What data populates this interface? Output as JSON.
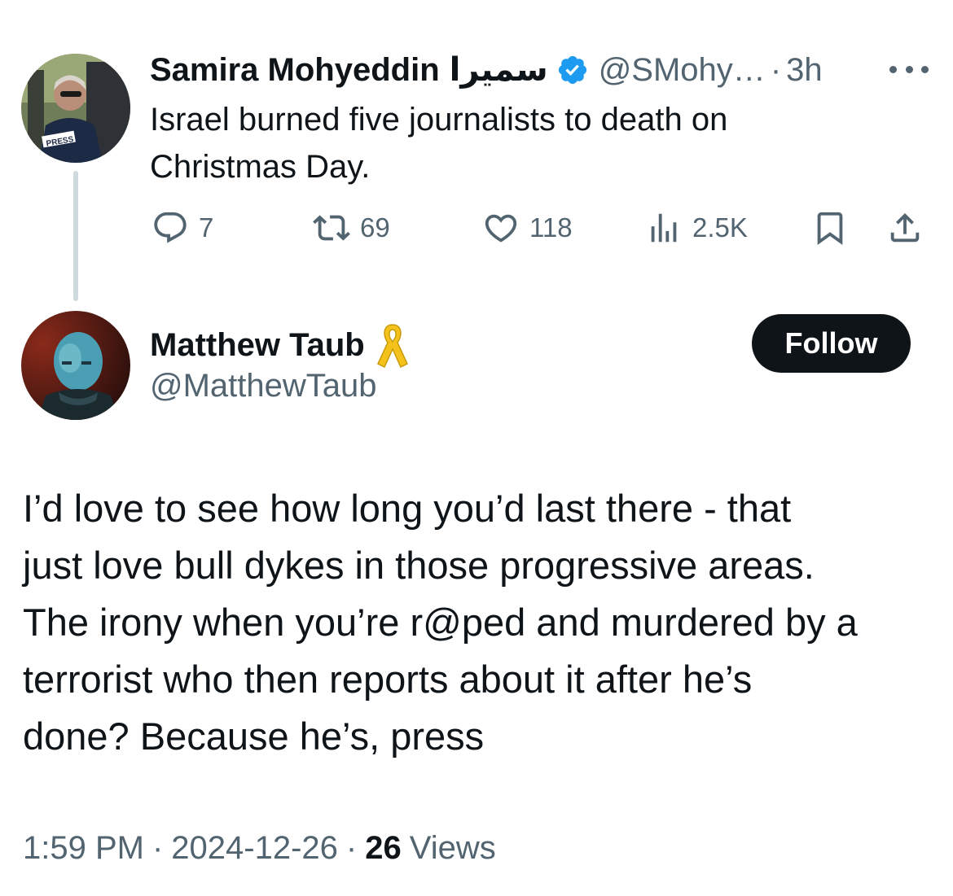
{
  "parent_tweet": {
    "author_name": "Samira Mohyeddin",
    "author_name_arabic": "سميرا",
    "handle": "@SMohy…",
    "separator": "·",
    "time": "3h",
    "text_line1": "Israel burned five journalists to death on",
    "text_line2": "Christmas Day.",
    "avatar_badge": "PRESS",
    "actions": {
      "replies": "7",
      "reposts": "69",
      "likes": "118",
      "views": "2.5K"
    }
  },
  "reply_tweet": {
    "author_name": "Matthew Taub",
    "handle": "@MatthewTaub",
    "follow_label": "Follow",
    "text_lines": [
      "I’d love to see how long you’d last there - that",
      "just love bull dykes in those progressive areas.",
      "The irony when you’re r@ped and murdered by a",
      "terrorist who then reports about it after he’s",
      "done? Because he’s, press"
    ],
    "time": "1:59 PM",
    "date": "2024-12-26",
    "separator": "·",
    "views_count": "26",
    "views_label": "Views"
  },
  "colors": {
    "text_primary": "#0f1419",
    "text_secondary": "#536471",
    "verified_blue": "#1d9bf0",
    "ribbon_yellow": "#f4c21b",
    "follow_bg": "#0f1419"
  },
  "icons": {
    "reply": "speech-bubble-icon",
    "repost": "repost-arrows-icon",
    "like": "heart-icon",
    "views": "bar-chart-icon",
    "bookmark": "bookmark-icon",
    "share": "share-upload-icon",
    "verified": "verified-badge-icon",
    "ribbon": "yellow-ribbon-icon",
    "more": "more-dots-icon"
  }
}
